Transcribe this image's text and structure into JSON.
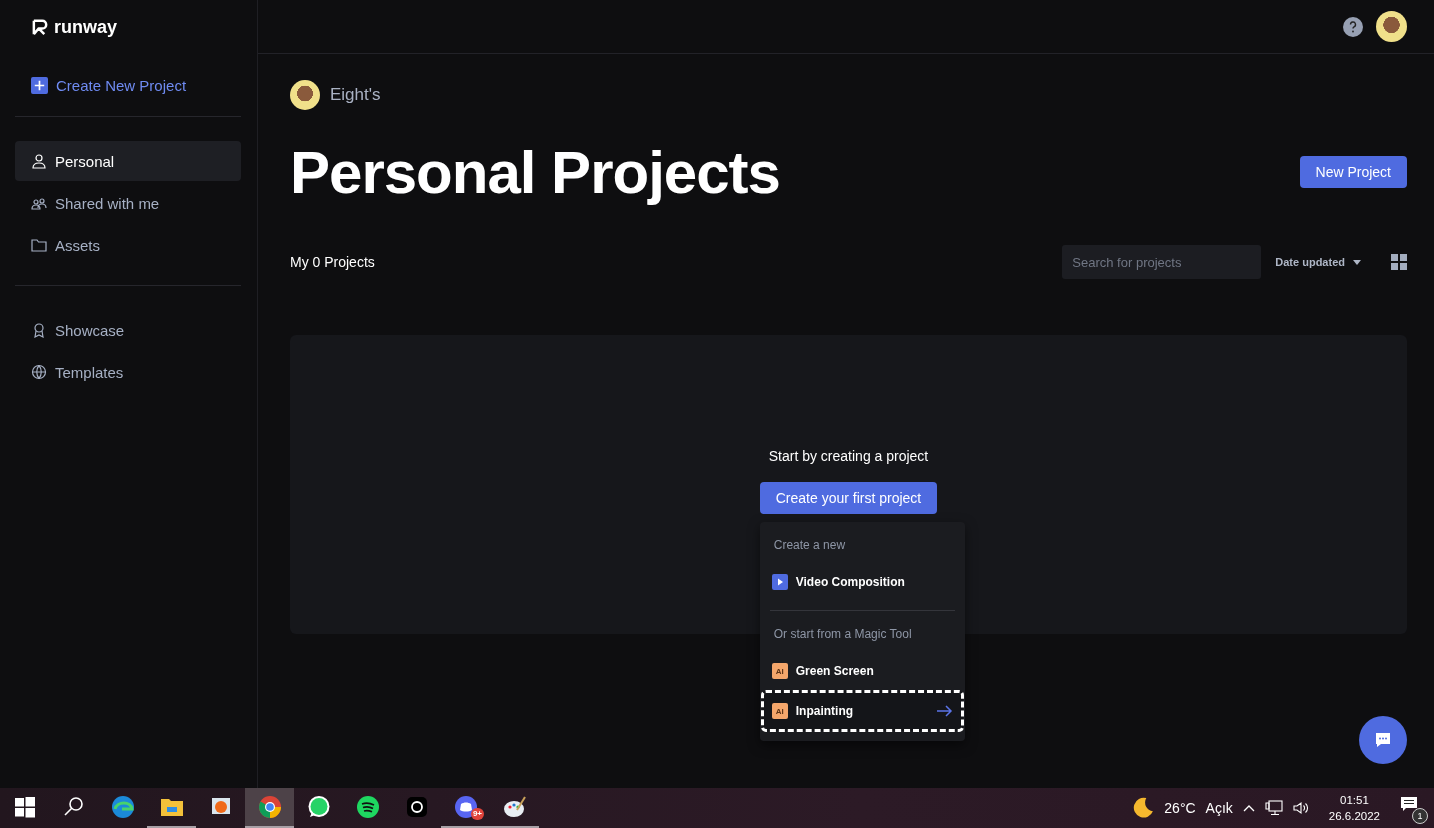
{
  "brand": {
    "name": "runway"
  },
  "sidebar": {
    "create_button": "Create New Project",
    "groups": [
      [
        {
          "label": "Personal",
          "kind": "person",
          "selected": true
        },
        {
          "label": "Shared with me",
          "kind": "people",
          "selected": false
        },
        {
          "label": "Assets",
          "kind": "folder",
          "selected": false
        }
      ],
      [
        {
          "label": "Showcase",
          "kind": "award",
          "selected": false
        },
        {
          "label": "Templates",
          "kind": "globe",
          "selected": false
        }
      ]
    ]
  },
  "header": {
    "owner": "Eight's",
    "title": "Personal Projects",
    "new_button": "New Project"
  },
  "toolbar": {
    "count": "My 0 Projects",
    "search": {
      "placeholder": "Search for projects"
    },
    "sort": "Date updated"
  },
  "empty_state": {
    "message": "Start by creating a project",
    "button": "Create your first project"
  },
  "menu": {
    "sections": [
      {
        "heading": "Create a new",
        "items": [
          {
            "label": "Video Composition",
            "kind": "video",
            "selected": false
          }
        ]
      },
      {
        "heading": "Or start from a Magic Tool",
        "items": [
          {
            "label": "Green Screen",
            "kind": "ai",
            "badge": "AI",
            "selected": false
          },
          {
            "label": "Inpainting",
            "kind": "ai",
            "badge": "AI",
            "selected": true
          }
        ]
      }
    ]
  },
  "taskbar": {
    "apps": [
      {
        "kind": "start",
        "running": false,
        "selected": false
      },
      {
        "kind": "search",
        "running": false,
        "selected": false
      },
      {
        "kind": "edge",
        "running": false,
        "selected": false
      },
      {
        "kind": "explorer",
        "running": true,
        "selected": false
      },
      {
        "kind": "photos",
        "running": false,
        "selected": false
      },
      {
        "kind": "chrome",
        "running": true,
        "selected": true
      },
      {
        "kind": "whatsapp",
        "running": false,
        "selected": false
      },
      {
        "kind": "spotify",
        "running": false,
        "selected": false
      },
      {
        "kind": "camera",
        "running": false,
        "selected": false
      },
      {
        "kind": "discord",
        "running": true,
        "selected": false,
        "badge": "9+"
      },
      {
        "kind": "paint",
        "running": true,
        "selected": false
      }
    ],
    "weather": {
      "temp": "26°C",
      "condition": "Açık"
    },
    "time": "01:51",
    "date": "26.6.2022",
    "notifications": "1"
  }
}
